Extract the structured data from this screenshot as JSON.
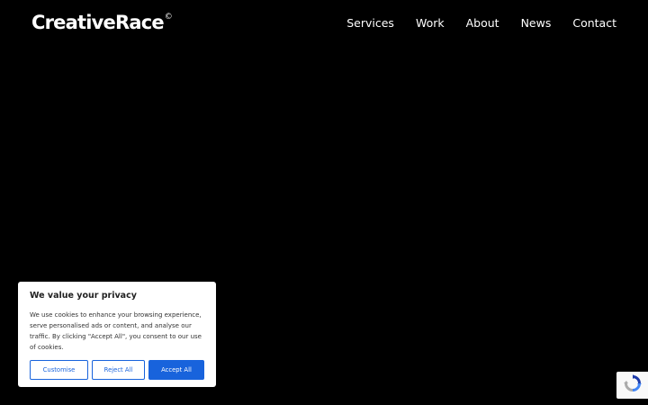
{
  "header": {
    "logo_text": "CreativeRace",
    "logo_mark": "©",
    "nav": [
      {
        "label": "Services"
      },
      {
        "label": "Work"
      },
      {
        "label": "About"
      },
      {
        "label": "News"
      },
      {
        "label": "Contact"
      }
    ]
  },
  "cookie_banner": {
    "title": "We value your privacy",
    "text": "We use cookies to enhance your browsing experience, serve personalised ads or content, and analyse our traffic. By clicking \"Accept All\", you consent to our use of cookies.",
    "customise_label": "Customise",
    "reject_label": "Reject All",
    "accept_label": "Accept All"
  },
  "colors": {
    "background": "#000000",
    "accent": "#1863dc",
    "text": "#ffffff"
  },
  "recaptcha": {
    "icon": "recaptcha-icon"
  }
}
